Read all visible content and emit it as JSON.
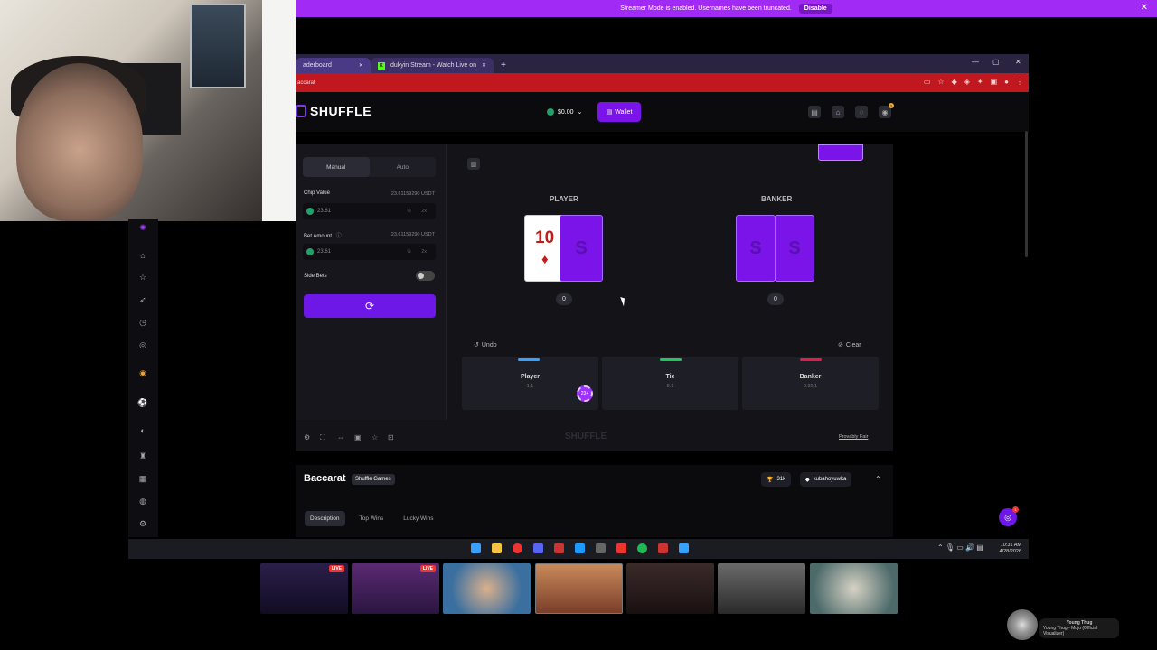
{
  "streamer_banner": {
    "text": "Streamer Mode is enabled. Usernames have been truncated.",
    "disable_label": "Disable"
  },
  "browser": {
    "tabs": [
      {
        "label": "aderboard"
      },
      {
        "label": "dukyin Stream - Watch Live on"
      }
    ],
    "address": "accarat"
  },
  "header": {
    "logo_text": "SHUFFLE",
    "balance": "$0.00",
    "wallet_label": "Wallet",
    "notif_count": "2"
  },
  "controls": {
    "mode_manual": "Manual",
    "mode_auto": "Auto",
    "chip_value_label": "Chip Value",
    "chip_value_usdt": "23.61159290 USDT",
    "chip_value": "23.61",
    "bet_amount_label": "Bet Amount",
    "bet_amount_usdt": "23.61159290 USDT",
    "bet_amount": "23.61",
    "half": "½",
    "double": "2x",
    "side_bets_label": "Side Bets"
  },
  "table": {
    "player_label": "PLAYER",
    "banker_label": "BANKER",
    "player_card_rank": "10",
    "player_card_suit": "♦",
    "card_back_glyph": "S",
    "player_score": "0",
    "banker_score": "0",
    "undo_label": "Undo",
    "clear_label": "Clear",
    "bets": [
      {
        "name": "Player",
        "odds": "1:1"
      },
      {
        "name": "Tie",
        "odds": "8:1"
      },
      {
        "name": "Banker",
        "odds": "0.95:1"
      }
    ],
    "chip_label": "23+",
    "watermark": "SHUFFLE",
    "provably_fair": "Provably Fair"
  },
  "game_info": {
    "title": "Baccarat",
    "provider": "Shuffle Games",
    "likes": "31k",
    "user": "kubahoyuwka",
    "tabs": [
      "Description",
      "Top Wins",
      "Lucky Wins"
    ]
  },
  "taskbar": {
    "time": "10:31 AM",
    "date": "4/28/2026"
  },
  "thumbs": {
    "live_label": "LIVE"
  },
  "music": {
    "title": "Young Thug",
    "subtitle": "Young Thug - Mojo (Official Visualizer)"
  },
  "support_badge": "1"
}
